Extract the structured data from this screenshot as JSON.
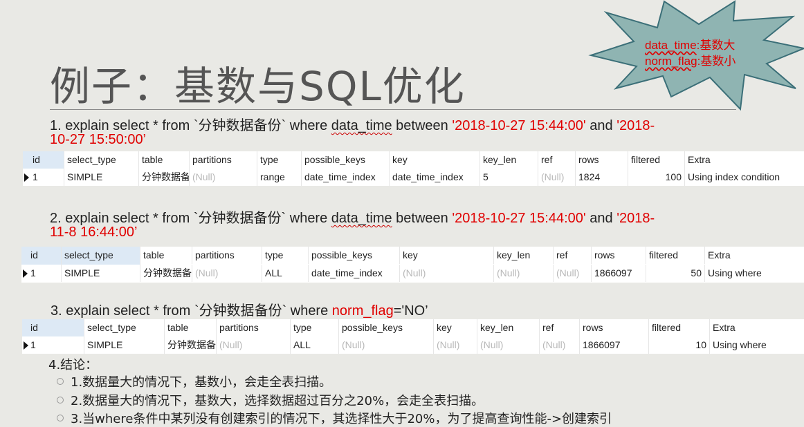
{
  "title": "例子：基数与SQL优化",
  "callout": {
    "line1_key": "data_time",
    "line1_val": ":基数大",
    "line2_key": "norm_flag",
    "line2_val": ":基数小"
  },
  "columns": [
    "id",
    "select_type",
    "table",
    "partitions",
    "type",
    "possible_keys",
    "key",
    "key_len",
    "ref",
    "rows",
    "filtered",
    "Extra"
  ],
  "queries": [
    {
      "prefix": "1. explain select * from `分钟数据备份` where ",
      "col": "data_time",
      "mid": " between ",
      "v1": "'2018-10-27 15:44:00'",
      "and": " and ",
      "v2a": "'2018-",
      "v2b": "10-27 15:50:00’",
      "row": {
        "id": "1",
        "select_type": "SIMPLE",
        "table": "分钟数据备",
        "partitions": "(Null)",
        "type": "range",
        "possible_keys": "date_time_index",
        "key": "date_time_index",
        "key_len": "5",
        "ref": "(Null)",
        "rows": "1824",
        "filtered": "100",
        "Extra": "Using index condition"
      }
    },
    {
      "prefix": "2. explain select * from `分钟数据备份` where ",
      "col": "data_time",
      "mid": " between ",
      "v1": "'2018-10-27 15:44:00'",
      "and": " and ",
      "v2a": "'2018-",
      "v2b": "11-8 16:44:00’",
      "row": {
        "id": "1",
        "select_type": "SIMPLE",
        "table": "分钟数据备",
        "partitions": "(Null)",
        "type": "ALL",
        "possible_keys": "date_time_index",
        "key": "(Null)",
        "key_len": "(Null)",
        "ref": "(Null)",
        "rows": "1866097",
        "filtered": "50",
        "Extra": "Using where"
      }
    },
    {
      "prefix": "3. explain select * from `分钟数据备份` where ",
      "col": "norm_flag",
      "suffix": "='NO’",
      "row": {
        "id": "1",
        "select_type": "SIMPLE",
        "table": "分钟数据备",
        "partitions": "(Null)",
        "type": "ALL",
        "possible_keys": "(Null)",
        "key": "(Null)",
        "key_len": "(Null)",
        "ref": "(Null)",
        "rows": "1866097",
        "filtered": "10",
        "Extra": "Using where"
      }
    }
  ],
  "conclusion": {
    "heading": "4.结论：",
    "items": [
      "1.数据量大的情况下，基数小，会走全表扫描。",
      "2.数据量大的情况下，基数大，选择数据超过百分之20%，会走全表扫描。",
      "3.当where条件中某列没有创建索引的情况下，其选择性大于20%，为了提高查询性能->创建索引"
    ]
  }
}
